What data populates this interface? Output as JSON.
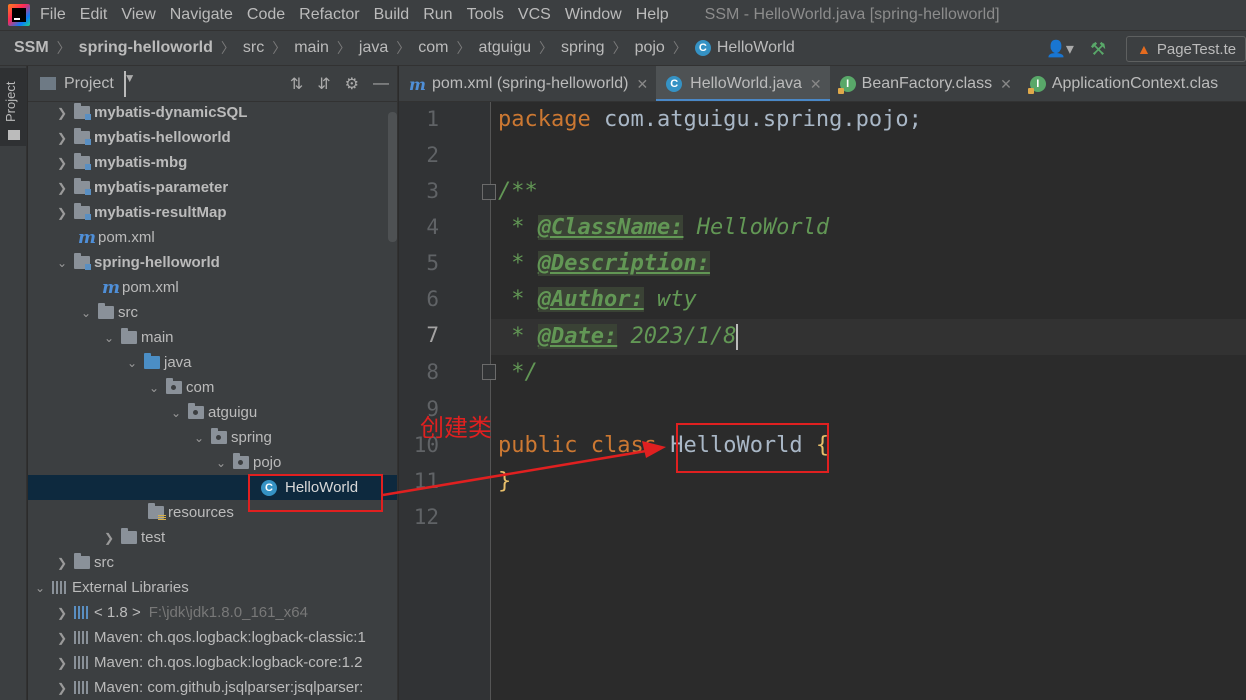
{
  "menu": {
    "items": [
      "File",
      "Edit",
      "View",
      "Navigate",
      "Code",
      "Refactor",
      "Build",
      "Run",
      "Tools",
      "VCS",
      "Window",
      "Help"
    ],
    "window_title": "SSM - HelloWorld.java [spring-helloworld]"
  },
  "breadcrumb": {
    "items": [
      "SSM",
      "spring-helloworld",
      "src",
      "main",
      "java",
      "com",
      "atguigu",
      "spring",
      "pojo",
      "HelloWorld"
    ],
    "run_config": "PageTest.te"
  },
  "tool_stripe": {
    "project_tab": "Project"
  },
  "project_panel": {
    "title": "Project",
    "tree": [
      {
        "label": "mybatis-dynamicSQL",
        "bold": true
      },
      {
        "label": "mybatis-helloworld",
        "bold": true
      },
      {
        "label": "mybatis-mbg",
        "bold": true
      },
      {
        "label": "mybatis-parameter",
        "bold": true
      },
      {
        "label": "mybatis-resultMap",
        "bold": true
      },
      {
        "label": "pom.xml"
      },
      {
        "label": "spring-helloworld",
        "bold": true
      },
      {
        "label": "pom.xml"
      },
      {
        "label": "src"
      },
      {
        "label": "main"
      },
      {
        "label": "java"
      },
      {
        "label": "com"
      },
      {
        "label": "atguigu"
      },
      {
        "label": "spring"
      },
      {
        "label": "pojo"
      },
      {
        "label": "HelloWorld"
      },
      {
        "label": "resources"
      },
      {
        "label": "test"
      },
      {
        "label": "src"
      },
      {
        "label": "External Libraries"
      },
      {
        "label": "< 1.8 >",
        "dim": "F:\\jdk\\jdk1.8.0_161_x64"
      },
      {
        "label": "Maven: ch.qos.logback:logback-classic:1"
      },
      {
        "label": "Maven: ch.qos.logback:logback-core:1.2"
      },
      {
        "label": "Maven: com.github.jsqlparser:jsqlparser:"
      }
    ]
  },
  "editor_tabs": [
    {
      "label": "pom.xml (spring-helloworld)"
    },
    {
      "label": "HelloWorld.java",
      "active": true
    },
    {
      "label": "BeanFactory.class"
    },
    {
      "label": "ApplicationContext.clas"
    }
  ],
  "editor": {
    "line_numbers": [
      "1",
      "2",
      "3",
      "4",
      "5",
      "6",
      "7",
      "8",
      "9",
      "10",
      "11",
      "12"
    ],
    "package_kw": "package",
    "package_name": "com.atguigu.spring.pojo;",
    "doc_open": "/**",
    "doc_star": "*",
    "tag_classname": "@ClassName:",
    "val_classname": "HelloWorld",
    "tag_description": "@Description:",
    "tag_author": "@Author:",
    "val_author": "wty",
    "tag_date": "@Date:",
    "val_date": "2023/1/8",
    "doc_close": "*/",
    "public_kw": "public",
    "class_kw": "class",
    "class_name": "HelloWorld",
    "open_brace": "{",
    "close_brace": "}"
  },
  "annotation": {
    "text": "创建类",
    "color": "#e02020"
  }
}
